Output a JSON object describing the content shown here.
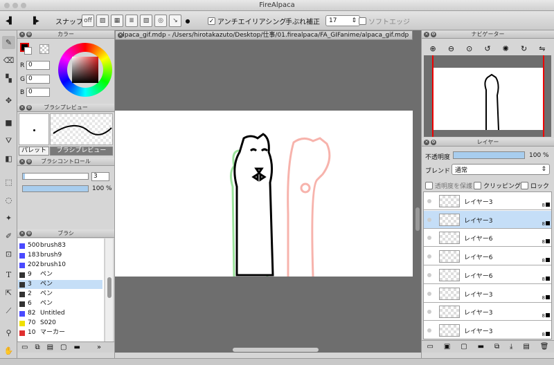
{
  "window": {
    "title": "FireAlpaca"
  },
  "toolbar": {
    "snap_label": "スナップ",
    "antialias_label": "アンチエイリアシング",
    "stabilizer_label": "手ぶれ補正",
    "stabilizer_value": "17",
    "softedge_label": "ソフトエッジ"
  },
  "color_panel": {
    "title": "カラー",
    "r_label": "R",
    "r": "0",
    "g_label": "G",
    "g": "0",
    "b_label": "B",
    "b": "0"
  },
  "brush_preview": {
    "title": "ブラシプレビュー",
    "tab_palette": "パレット",
    "tab_preview": "ブラシプレビュー"
  },
  "brush_control": {
    "title": "ブラシコントロール",
    "size": "3",
    "opacity": "100 %",
    "size_fraction": 0.03,
    "opacity_fraction": 1.0
  },
  "brush_panel": {
    "title": "ブラシ",
    "items": [
      {
        "size": "500",
        "name": "brush83",
        "color": "#4a4aff"
      },
      {
        "size": "183",
        "name": "brush9",
        "color": "#4a4aff"
      },
      {
        "size": "202",
        "name": "brush10",
        "color": "#4a4aff"
      },
      {
        "size": "9",
        "name": "ペン",
        "color": "#333333"
      },
      {
        "size": "3",
        "name": "ペン",
        "color": "#333333"
      },
      {
        "size": "2",
        "name": "ペン",
        "color": "#333333"
      },
      {
        "size": "6",
        "name": "ペン",
        "color": "#333333"
      },
      {
        "size": "82",
        "name": "Untitled",
        "color": "#4a4aff"
      },
      {
        "size": "70",
        "name": "S020",
        "color": "#f0e000"
      },
      {
        "size": "10",
        "name": "マーカー",
        "color": "#e03030"
      }
    ],
    "selected_index": 4
  },
  "document": {
    "tab_title": "alpaca_gif.mdp - /Users/hirotakazuto/Desktop/仕事/01.firealpaca/FA_GIFanime/alpaca_gif.mdp"
  },
  "navigator": {
    "title": "ナビゲーター"
  },
  "layer_panel": {
    "title": "レイヤー",
    "opacity_label": "不透明度",
    "opacity_value": "100 %",
    "opacity_fraction": 1.0,
    "blend_label": "ブレンド",
    "blend_value": "通常",
    "protect_alpha": "透明度を保護",
    "clipping": "クリッピング",
    "lock": "ロック",
    "layers": [
      {
        "name": "レイヤー3",
        "bits": "8"
      },
      {
        "name": "レイヤー3",
        "bits": "8"
      },
      {
        "name": "レイヤー6",
        "bits": "8"
      },
      {
        "name": "レイヤー6",
        "bits": "8"
      },
      {
        "name": "レイヤー6",
        "bits": "8"
      },
      {
        "name": "レイヤー3",
        "bits": "8"
      },
      {
        "name": "レイヤー3",
        "bits": "8"
      },
      {
        "name": "レイヤー3",
        "bits": "8"
      }
    ],
    "selected_index": 1
  }
}
